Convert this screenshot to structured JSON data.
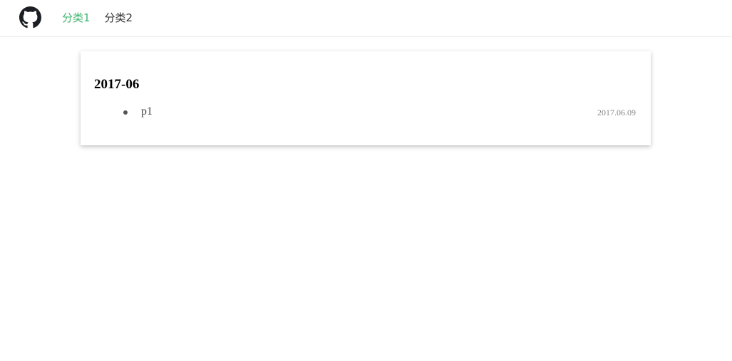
{
  "header": {
    "logo_icon": "github-icon",
    "nav": [
      {
        "label": "分类1",
        "active": true
      },
      {
        "label": "分类2",
        "active": false
      }
    ],
    "accent_color": "#3fb56e"
  },
  "archive": {
    "month": "2017-06",
    "posts": [
      {
        "title": "p1",
        "date": "2017.06.09"
      }
    ]
  }
}
